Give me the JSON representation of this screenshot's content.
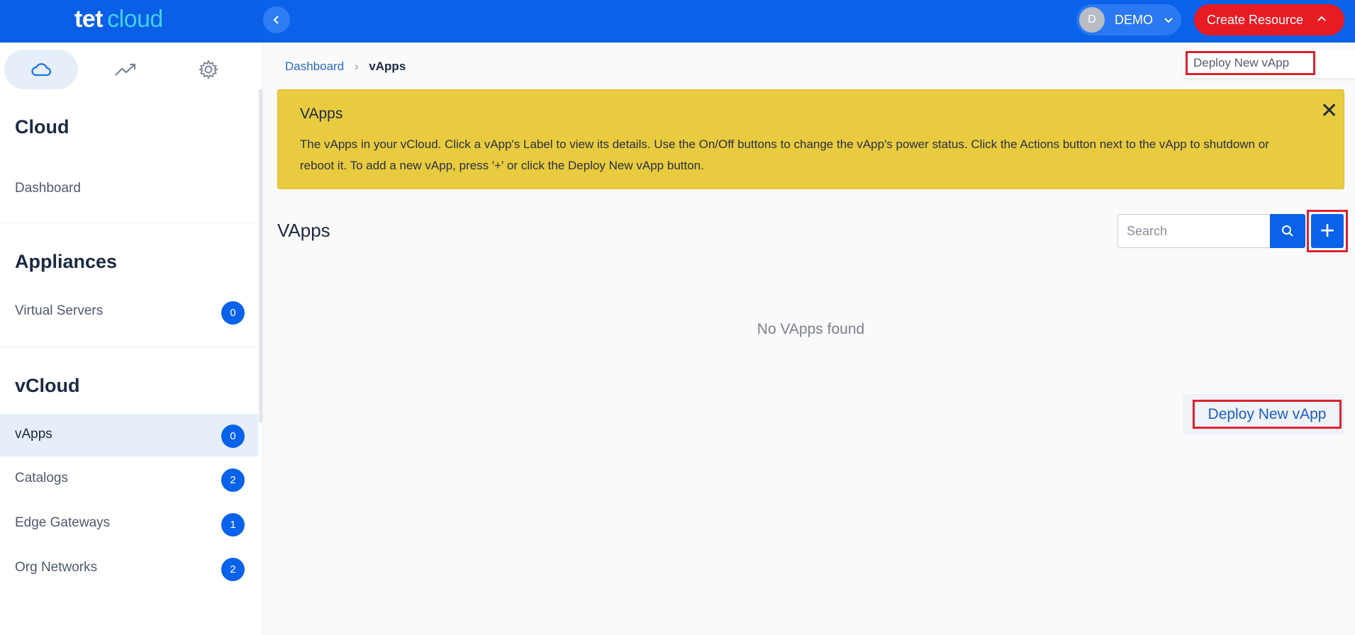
{
  "app": {
    "logo_tet": "tet",
    "logo_cloud": "cloud"
  },
  "header": {
    "collapse_icon": "chevron-left-icon",
    "user_initial": "D",
    "user_name": "DEMO",
    "create_resource_label": "Create Resource",
    "dropdown_items": [
      "Deploy New vApp"
    ]
  },
  "sidebar": {
    "tabs": [
      {
        "icon": "cloud-icon",
        "active": true
      },
      {
        "icon": "trending-up-icon",
        "active": false
      },
      {
        "icon": "gear-icon",
        "active": false
      }
    ],
    "sections": [
      {
        "heading": "Cloud",
        "items": [
          {
            "label": "Dashboard"
          }
        ]
      },
      {
        "heading": "Appliances",
        "items": [
          {
            "label": "Virtual Servers",
            "count": "0"
          }
        ]
      },
      {
        "heading": "vCloud",
        "items": [
          {
            "label": "vApps",
            "count": "0",
            "active": true
          },
          {
            "label": "Catalogs",
            "count": "2"
          },
          {
            "label": "Edge Gateways",
            "count": "1"
          },
          {
            "label": "Org Networks",
            "count": "2"
          }
        ]
      }
    ]
  },
  "breadcrumb": {
    "items": [
      "Dashboard",
      "vApps"
    ],
    "separator": "›"
  },
  "alert": {
    "title": "VApps",
    "text": "The vApps in your vCloud. Click a vApp's Label to view its details. Use the On/Off buttons to change the vApp's power status. Click the Actions button next to the vApp to shutdown or reboot it. To add a new vApp, press '+' or click the Deploy New vApp button.",
    "close_glyph": "✕"
  },
  "main": {
    "title": "VApps",
    "search_placeholder": "Search",
    "add_glyph": "+",
    "empty_message": "No VApps found",
    "deploy_link": "Deploy New vApp"
  },
  "colors": {
    "primary": "#0a62ea",
    "danger": "#e81a22",
    "alert": "#e9cb3f",
    "highlight_border": "#e02030"
  }
}
